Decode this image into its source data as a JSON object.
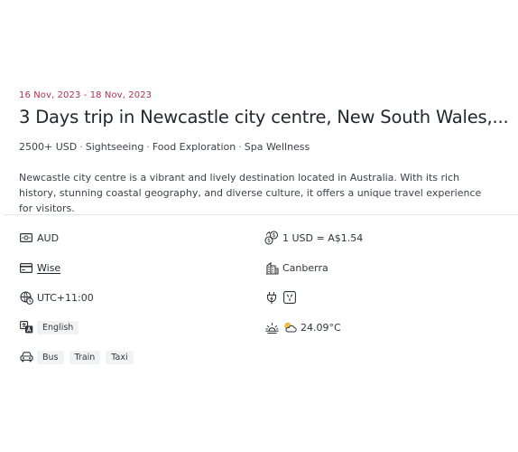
{
  "trip": {
    "dates": "16 Nov, 2023 - 18 Nov, 2023",
    "title": "3 Days trip in Newcastle city centre, New South Wales,...",
    "tags": [
      "2500+ USD",
      "Sightseeing",
      "Food Exploration",
      "Spa Wellness"
    ],
    "description": "Newcastle city centre is a vibrant and lively destination located in Australia. With its rich history, stunning coastal geography, and diverse culture, it offers a unique travel experience for visitors."
  },
  "details": {
    "currency": {
      "icon": "money-bill-icon",
      "value": "AUD"
    },
    "exchange_rate": {
      "icon": "currency-exchange-icon",
      "value": "1 USD = A$1.54"
    },
    "payment": {
      "icon": "credit-card-icon",
      "value": "Wise"
    },
    "capital": {
      "icon": "city-buildings-icon",
      "value": "Canberra"
    },
    "timezone": {
      "icon": "globe-clock-icon",
      "value": "UTC+11:00"
    },
    "power": {
      "icon": "plug-icon",
      "socket_icon": "power-socket-type-i-icon"
    },
    "language": {
      "icon": "translate-icon",
      "value": "English"
    },
    "weather": {
      "icon": "sun-horizon-icon",
      "condition_icon": "partly-cloudy-icon",
      "value": "24.09°C"
    },
    "transport": {
      "icon": "car-icon",
      "options": [
        "Bus",
        "Train",
        "Taxi"
      ]
    }
  },
  "colors": {
    "accent": "#b4314b",
    "text": "#2b2f36",
    "chip_bg": "#f1f2f4",
    "divider": "#e6e7ea",
    "weather_icon": "#e5a623"
  }
}
